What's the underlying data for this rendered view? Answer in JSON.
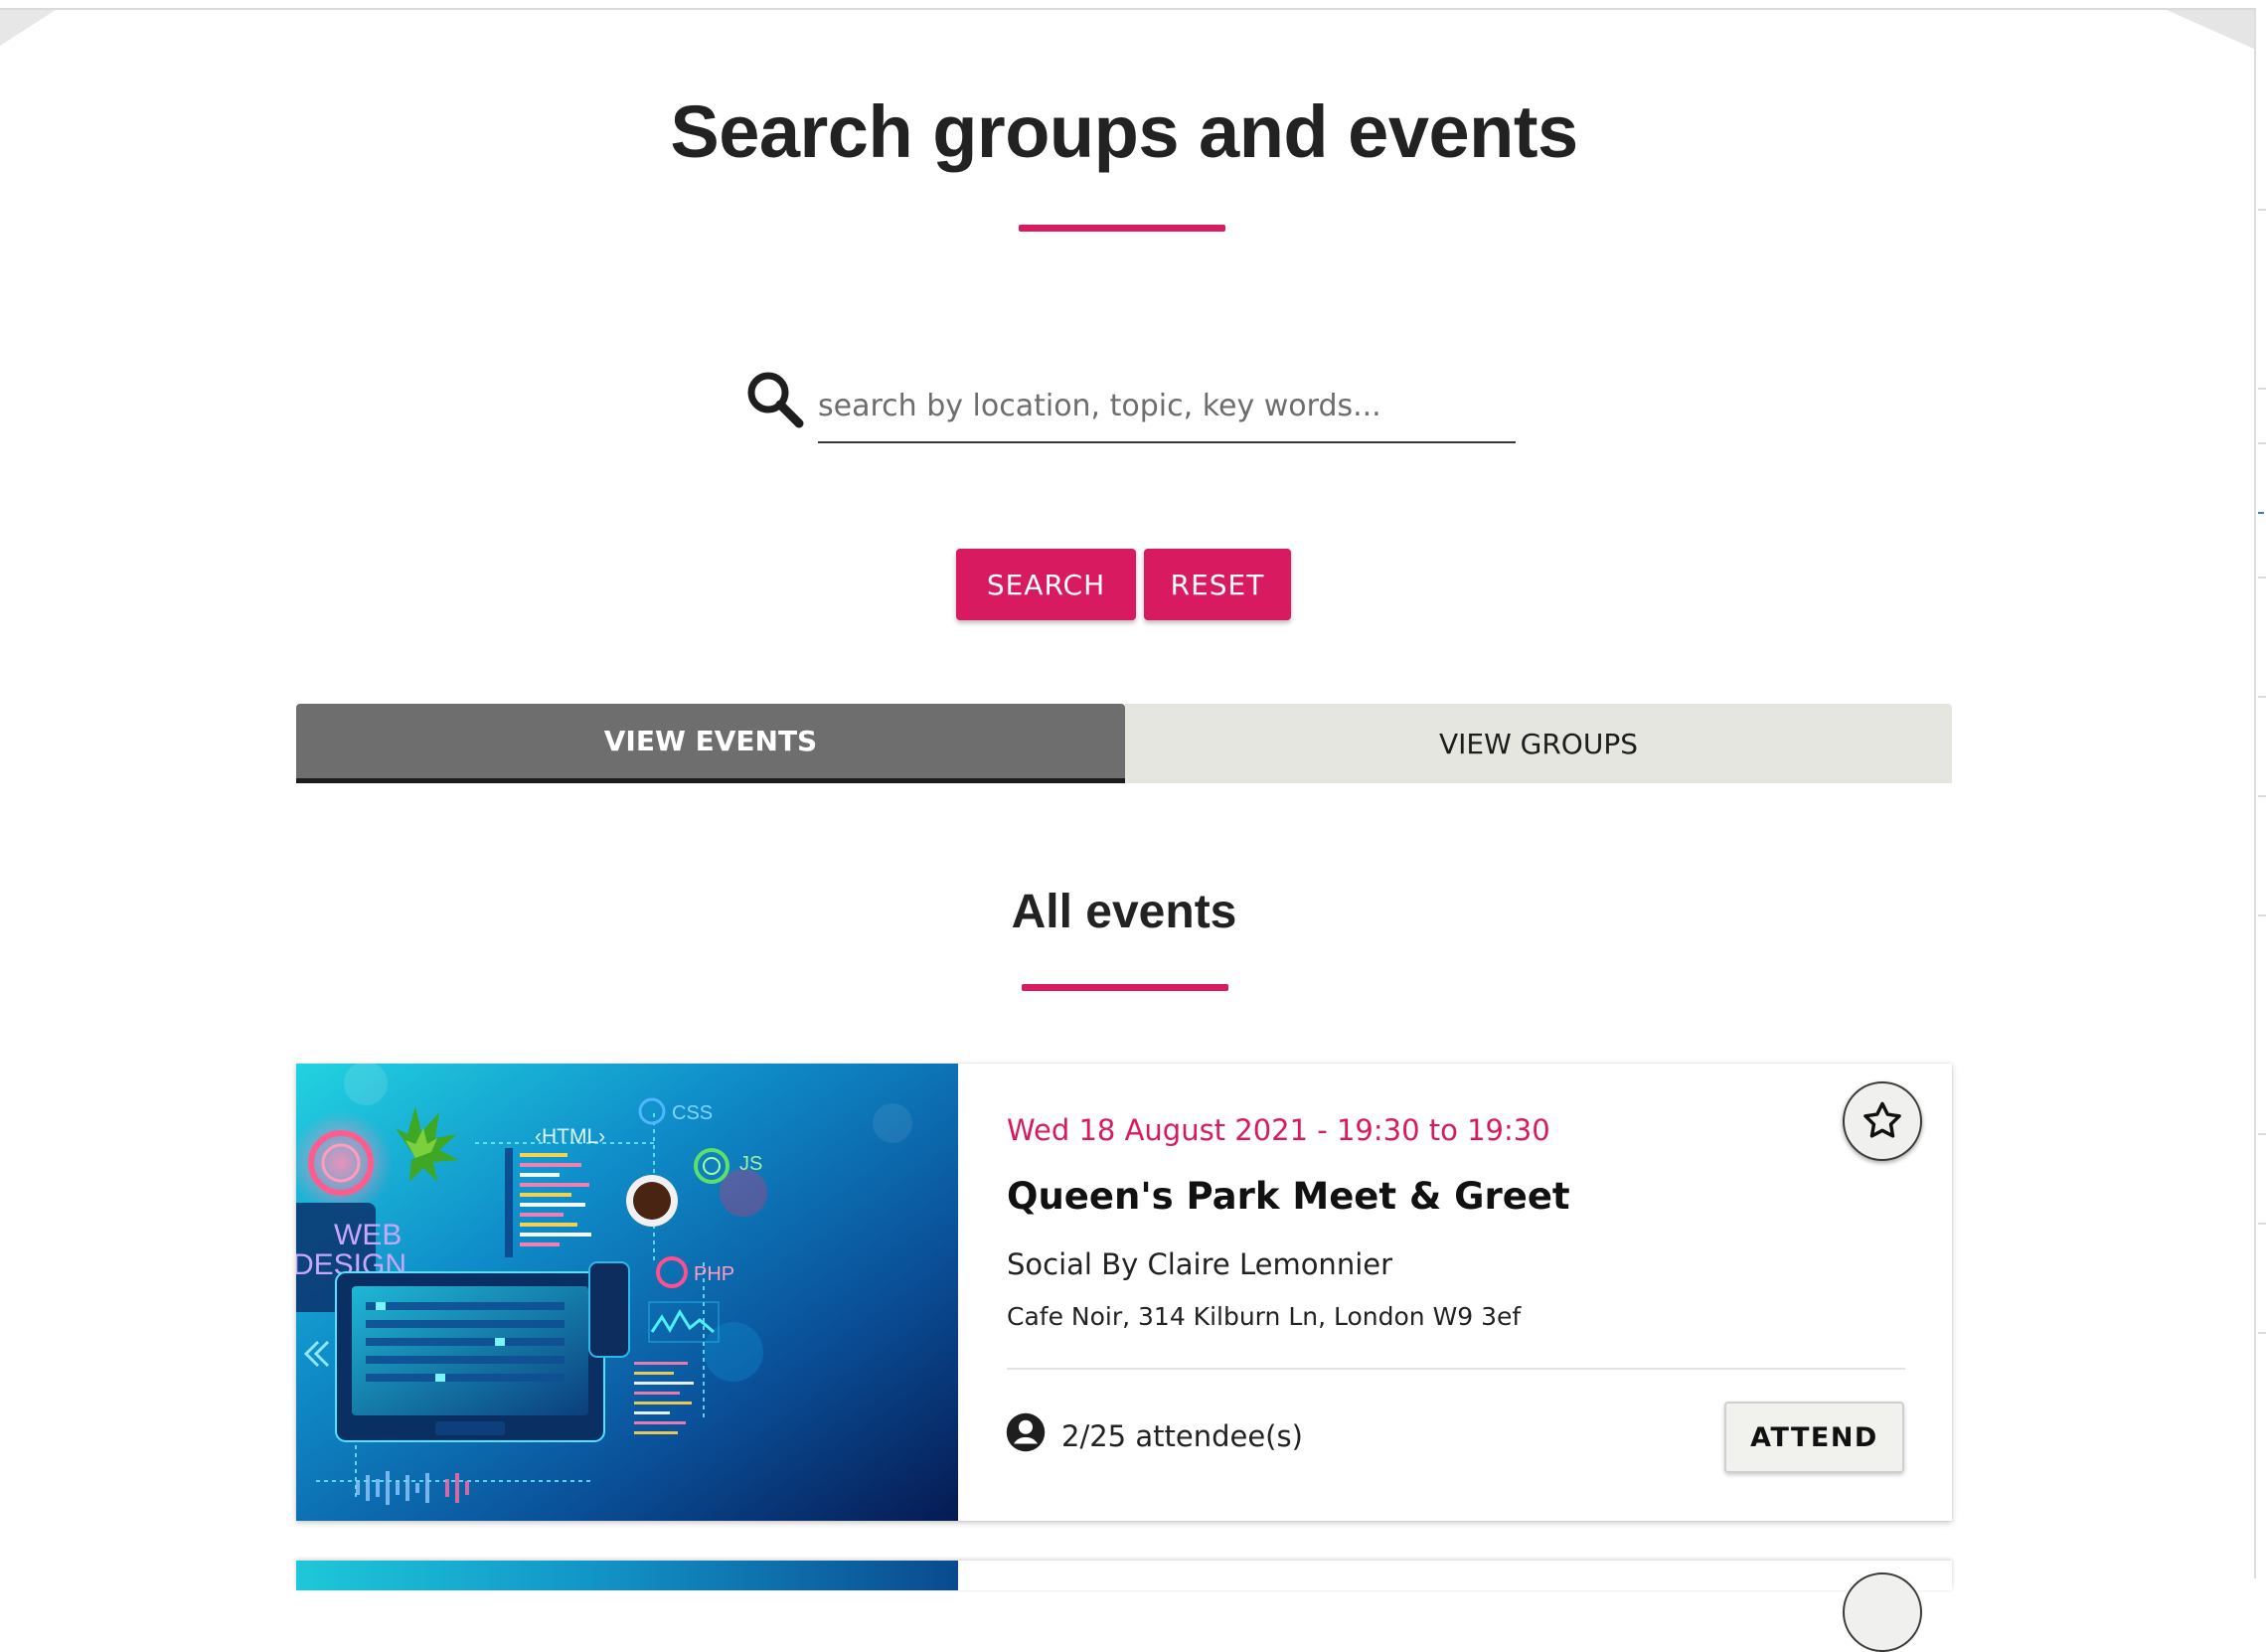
{
  "page": {
    "title": "Search groups and events",
    "accent_color": "#d81b60"
  },
  "search": {
    "placeholder": "search by location, topic, key words...",
    "value": "",
    "search_label": "SEARCH",
    "reset_label": "RESET"
  },
  "tabs": [
    {
      "label": "VIEW EVENTS",
      "active": true
    },
    {
      "label": "VIEW GROUPS",
      "active": false
    }
  ],
  "section": {
    "title": "All events"
  },
  "events": [
    {
      "date": "Wed 18 August 2021 - 19:30 to 19:30",
      "title": "Queen's Park Meet & Greet",
      "organizer": "Social By Claire Lemonnier",
      "address": "Cafe Noir, 314 Kilburn Ln, London W9 3ef",
      "attendees": "2/25 attendee(s)",
      "attend_label": "ATTEND",
      "favorite_icon": "star-outline-icon",
      "image": {
        "labels": {
          "html": "‹HTML›",
          "css": "CSS",
          "js": "JS",
          "php": "PHP",
          "web": "WEB",
          "design": "DESIGN"
        }
      }
    }
  ]
}
